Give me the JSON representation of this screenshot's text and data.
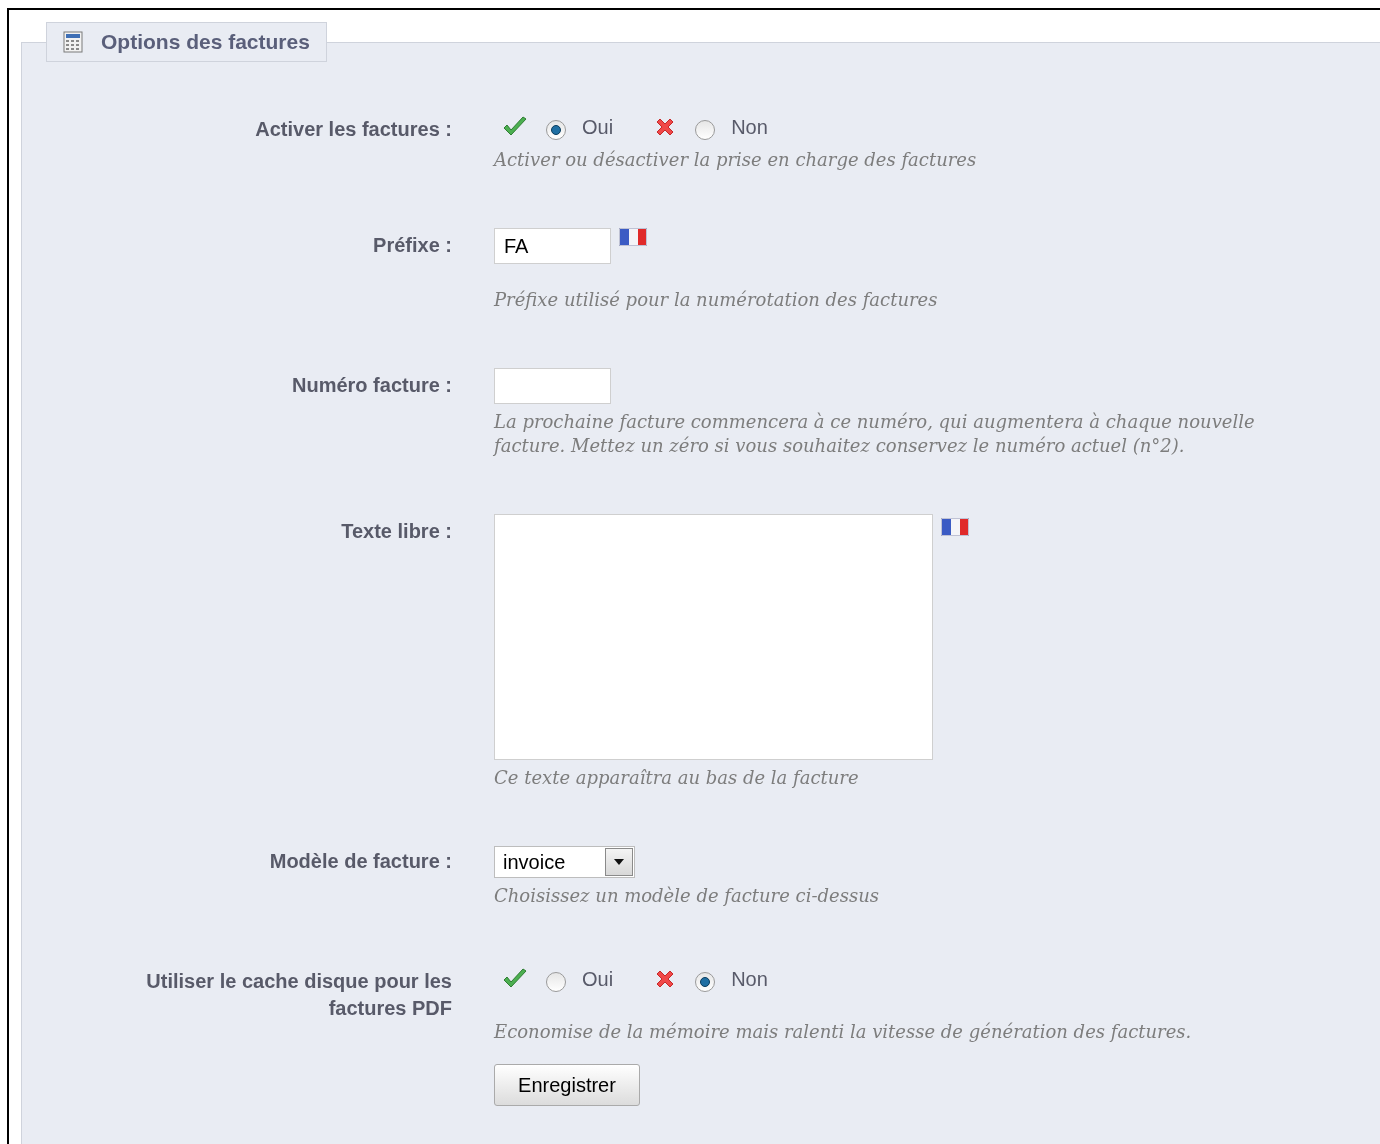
{
  "legend": {
    "title": "Options des factures"
  },
  "fields": [
    {
      "kind": "radio",
      "label": "Activer les factures :",
      "options": [
        {
          "label": "Oui",
          "selected": true
        },
        {
          "label": "Non",
          "selected": false
        }
      ],
      "help": "Activer ou désactiver la prise en charge des factures"
    },
    {
      "kind": "text",
      "label": "Préfixe :",
      "value": "FA",
      "flag": true,
      "help": "Préfixe utilisé pour la numérotation des factures"
    },
    {
      "kind": "text",
      "label": "Numéro facture :",
      "help": "La prochaine facture commencera à ce numéro, qui augmentera à chaque nouvelle facture. Mettez un zéro si vous souhaitez conservez le numéro actuel (n°2)."
    },
    {
      "kind": "textarea",
      "label": "Texte libre :",
      "flag": true,
      "help": "Ce texte apparaîtra au bas de la facture"
    },
    {
      "kind": "select",
      "label": "Modèle de facture :",
      "value": "invoice",
      "help": "Choisissez un modèle de facture ci-dessus"
    },
    {
      "kind": "radio",
      "label": "Utiliser le cache disque pour les factures PDF",
      "options": [
        {
          "label": "Oui",
          "selected": false
        },
        {
          "label": "Non",
          "selected": true
        }
      ],
      "help": "Economise de la mémoire mais ralenti la vitesse de génération des factures."
    }
  ],
  "button": "Enregistrer"
}
